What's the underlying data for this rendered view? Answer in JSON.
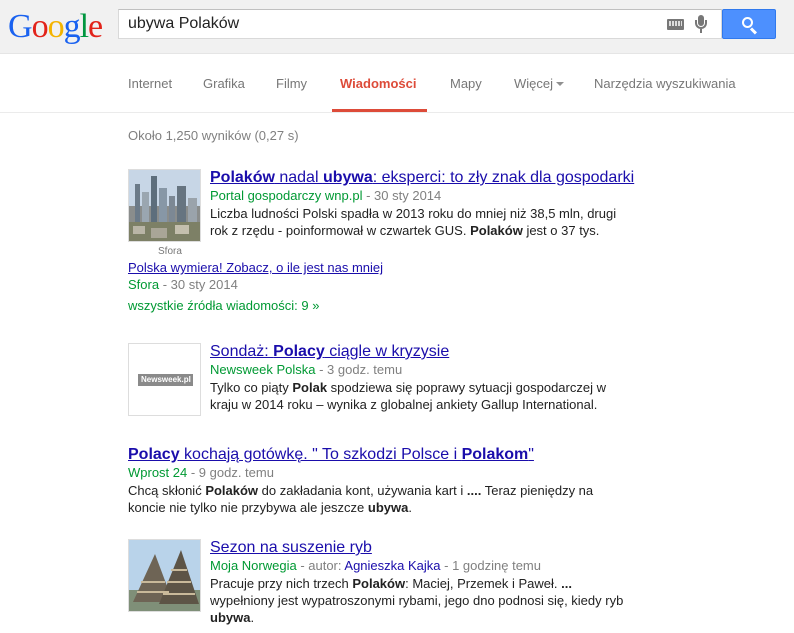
{
  "logo": {
    "letters": [
      "G",
      "o",
      "o",
      "g",
      "l",
      "e"
    ],
    "colors": [
      "#1a62f0",
      "#e2231a",
      "#f4b400",
      "#1a62f0",
      "#00963f",
      "#e2231a"
    ]
  },
  "search": {
    "query": "ubywa Polaków"
  },
  "tabs": [
    {
      "label": "Internet"
    },
    {
      "label": "Grafika"
    },
    {
      "label": "Filmy"
    },
    {
      "label": "Wiadomości",
      "active": true
    },
    {
      "label": "Mapy"
    },
    {
      "label": "Więcej"
    },
    {
      "label": "Narzędzia wyszukiwania"
    }
  ],
  "stats": "Około 1,250 wyników (0,27 s)",
  "results": [
    {
      "title_parts": [
        "Polaków",
        " nadal ",
        "ubywa",
        ": eksperci: to zły znak dla gospodarki"
      ],
      "source": "Portal gospodarczy wnp.pl",
      "time": " - 30 sty 2014",
      "snippet_line1": "Liczba ludności Polski spadła w 2013 roku do mniej niż 38,5 mln, drugi",
      "snippet_line2_parts": [
        "rok z rzędu - poinformował w czwartek GUS. ",
        "Polaków",
        " jest o 37 tys."
      ],
      "thumb_caption": "Sfora",
      "sub_link": "Polska wymiera! Zobacz, o ile jest nas mniej",
      "sub_source": "Sfora",
      "sub_time": " - 30 sty 2014",
      "all_sources": "wszystkie źródła wiadomości: 9 »"
    },
    {
      "title_parts": [
        "Sondaż: ",
        "Polacy",
        " ciągle w kryzysie"
      ],
      "source": "Newsweek Polska",
      "time": " - 3 godz. temu",
      "thumb_label": "Newsweek.pl",
      "snippet_line1_parts": [
        "Tylko co piąty ",
        "Polak",
        " spodziewa się poprawy sytuacji gospodarczej w"
      ],
      "snippet_line2": "kraju w 2014 roku – wynika z globalnej ankiety Gallup International."
    },
    {
      "title_parts": [
        "Polacy",
        " kochają gotówkę. \" To szkodzi Polsce i ",
        "Polakom",
        "\""
      ],
      "source": "Wprost 24",
      "time": " - 9 godz. temu",
      "snippet_line1_parts": [
        "Chcą skłonić ",
        "Polaków",
        " do zakładania kont, używania kart i ",
        "....",
        " Teraz pieniędzy na"
      ],
      "snippet_line2_parts": [
        "koncie nie tylko nie przybywa ale jeszcze ",
        "ubywa",
        "."
      ]
    },
    {
      "title": "Sezon na suszenie ryb",
      "source": "Moja Norwegia",
      "author_prefix": " - autor: ",
      "author": "Agnieszka Kajka",
      "time": " - 1 godzinę temu",
      "snippet_line1_parts": [
        "Pracuje przy nich trzech ",
        "Polaków",
        ": Maciej, Przemek i Paweł. ",
        "..."
      ],
      "snippet_line2": "wypełniony jest wypatroszonymi rybami, jego dno podnosi się, kiedy ryb",
      "snippet_line3": "ubywa",
      "snippet_line3_tail": "."
    }
  ]
}
